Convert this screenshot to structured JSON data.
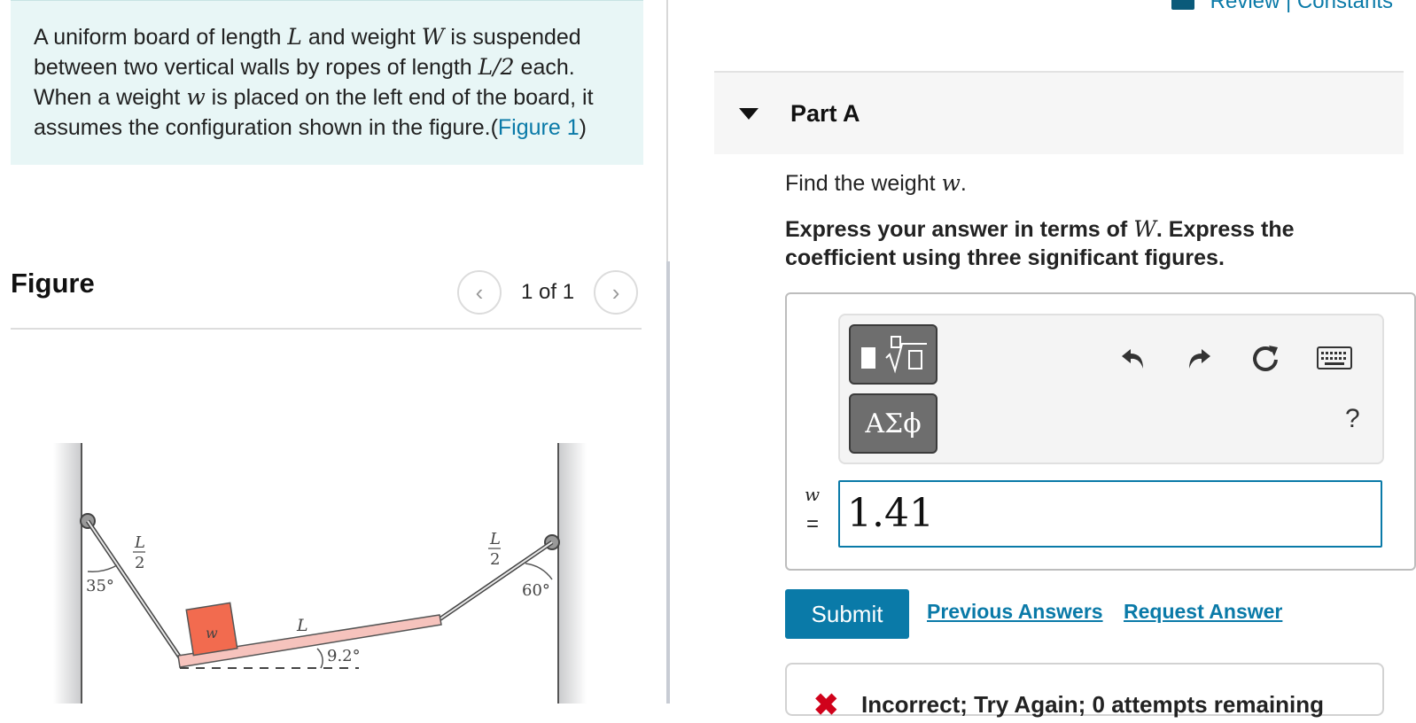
{
  "intro": {
    "t1": "A uniform board of length ",
    "L": "L",
    "t2": " and weight ",
    "W": "W",
    "t3": " is suspended between two vertical walls by ropes of length ",
    "Lhalf": "L/2",
    "t4": " each. When a weight ",
    "w": "w",
    "t5": " is placed on the left end of the board, it assumes the configuration shown in the figure.(",
    "figure_link": "Figure 1",
    "t6": ")"
  },
  "figure": {
    "heading": "Figure",
    "pager_text": "1 of 1",
    "prev_icon": "chevron-left-icon",
    "next_icon": "chevron-right-icon",
    "labels": {
      "L_num": "L",
      "L_den": "2",
      "angle_left": "35°",
      "angle_right": "60°",
      "board_angle": "9.2°",
      "board_L": "L",
      "weight": "w"
    },
    "colors": {
      "board": "#f6c3bd",
      "weight": "#f26b4f",
      "wall": "#c9cacc"
    }
  },
  "header": {
    "review_label": "Review | Constants",
    "review_icon": "book-icon"
  },
  "part": {
    "label": "Part A",
    "question_text": "Find the weight ",
    "question_var": "w",
    "question_end": ".",
    "instr_1": "Express your answer in terms of ",
    "instr_var": "W",
    "instr_2": ". Express the coefficient using three significant figures."
  },
  "toolbar": {
    "templates_icon": "math-templates-icon",
    "greek_label": "ΑΣϕ",
    "undo_icon": "undo-icon",
    "redo_icon": "redo-icon",
    "reset_icon": "reset-icon",
    "keyboard_icon": "keyboard-icon",
    "help_label": "?"
  },
  "answer": {
    "variable": "w",
    "equals": "=",
    "value": "1.41"
  },
  "actions": {
    "submit": "Submit",
    "previous": "Previous Answers",
    "request": "Request Answer"
  },
  "feedback": {
    "text": "Incorrect; Try Again; 0 attempts remaining"
  },
  "colors": {
    "accent": "#0a7aa8",
    "intro_bg": "#e8f6f6",
    "error": "#d0021b"
  }
}
